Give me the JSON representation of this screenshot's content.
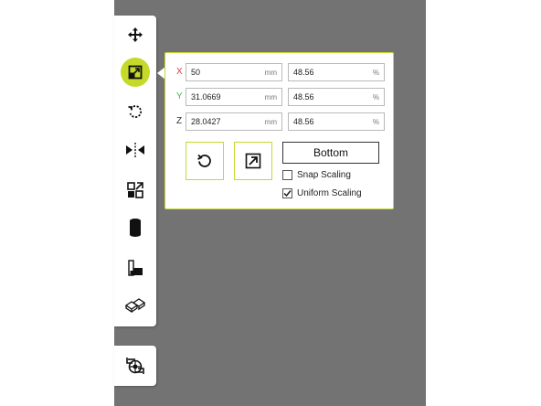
{
  "tools": [
    {
      "name": "move-tool",
      "icon": "move-arrows-icon"
    },
    {
      "name": "scale-tool",
      "icon": "scale-icon",
      "active": true
    },
    {
      "name": "rotate-tool",
      "icon": "rotate-icon"
    },
    {
      "name": "mirror-tool",
      "icon": "mirror-icon"
    },
    {
      "name": "per-model-settings-tool",
      "icon": "per-model-settings-icon"
    },
    {
      "name": "support-blocker-tool",
      "icon": "cylinder-icon"
    },
    {
      "name": "lay-flat-tool",
      "icon": "stairs-icon"
    },
    {
      "name": "arrange-tool",
      "icon": "blocks-icon"
    }
  ],
  "bottom_tool": {
    "icon": "view-icon"
  },
  "scale_panel": {
    "rows": [
      {
        "axis": "X",
        "axis_color": "#e53935",
        "mm": "50",
        "mm_unit": "mm",
        "percent": "48.56",
        "percent_unit": "%"
      },
      {
        "axis": "Y",
        "axis_color": "#4caf50",
        "mm": "31.0669",
        "mm_unit": "mm",
        "percent": "48.56",
        "percent_unit": "%"
      },
      {
        "axis": "Z",
        "axis_color": "#333333",
        "mm": "28.0427",
        "mm_unit": "mm",
        "percent": "48.56",
        "percent_unit": "%"
      }
    ],
    "reset_icon": "reset-icon",
    "scale_to_max_icon": "scale-to-max-icon",
    "bottom_label": "Bottom",
    "snap_scaling": {
      "label": "Snap Scaling",
      "checked": false
    },
    "uniform_scaling": {
      "label": "Uniform Scaling",
      "checked": true
    }
  },
  "colors": {
    "accent": "#c5d928",
    "viewport": "#737373"
  }
}
